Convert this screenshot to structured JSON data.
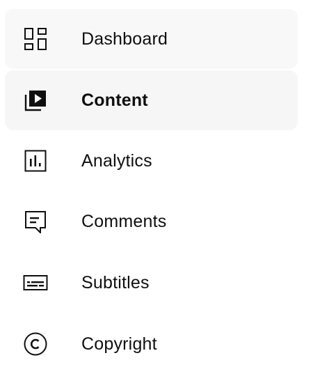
{
  "sidebar": {
    "items": [
      {
        "label": "Dashboard",
        "icon": "dashboard-icon",
        "state": "hovered"
      },
      {
        "label": "Content",
        "icon": "content-icon",
        "state": "active"
      },
      {
        "label": "Analytics",
        "icon": "analytics-icon",
        "state": "default"
      },
      {
        "label": "Comments",
        "icon": "comments-icon",
        "state": "default"
      },
      {
        "label": "Subtitles",
        "icon": "subtitles-icon",
        "state": "default"
      },
      {
        "label": "Copyright",
        "icon": "copyright-icon",
        "state": "default"
      }
    ],
    "colors": {
      "text": "#0f0f0f",
      "hover_bg": "#f8f8f8",
      "active_bg": "#f6f6f6"
    }
  }
}
